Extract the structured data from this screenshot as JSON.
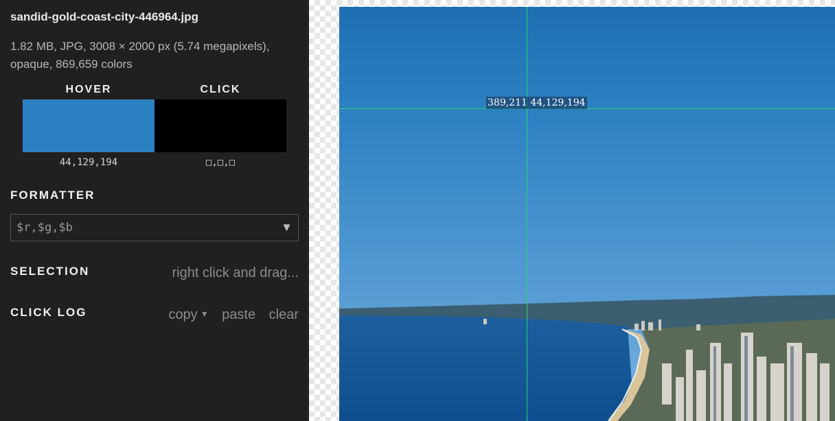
{
  "file": {
    "name": "sandid-gold-coast-city-446964.jpg",
    "info": "1.82 MB, JPG, 3008 × 2000 px (5.74 megapixels), opaque, 869,659 colors"
  },
  "swatches": {
    "hover": {
      "label": "HOVER",
      "value": "44,129,194",
      "color": "#2c81c2"
    },
    "click": {
      "label": "CLICK",
      "value": "□,□,□",
      "color": "#000000"
    }
  },
  "formatter": {
    "label": "FORMATTER",
    "value": "$r,$g,$b",
    "arrow": "▼"
  },
  "selection": {
    "label": "SELECTION",
    "hint": "right click and drag..."
  },
  "click_log": {
    "label": "CLICK LOG",
    "copy": "copy",
    "paste": "paste",
    "clear": "clear"
  },
  "canvas": {
    "cursor_readout": "389,211 44,129,194",
    "crosshair_color": "#28d46a"
  }
}
